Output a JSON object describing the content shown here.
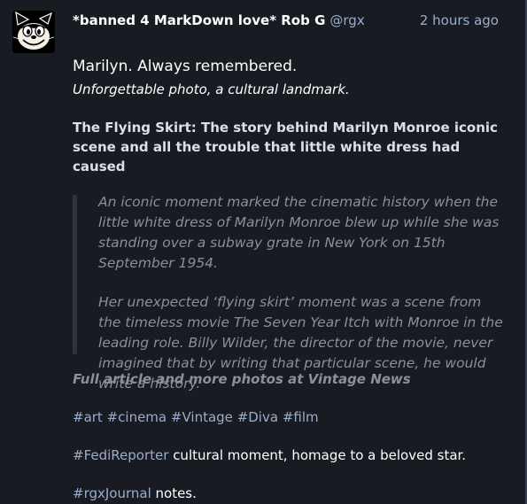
{
  "post": {
    "display_name": "*banned 4 MarkDown love* Rob G",
    "acct": "@rgx",
    "timestamp": "2 hours ago",
    "lead": "Marilyn. Always remembered.",
    "subtitle": "Unforgettable photo, a cultural landmark.",
    "article_title": "The Flying Skirt: The story behind Marilyn Monroe iconic scene and all the trouble that little white dress had caused",
    "quote_paragraphs": [
      "An iconic moment marked the cinematic history when the little white dress of Marilyn Monroe blew up while she was standing over a subway grate in New York on 15th September 1954.",
      "Her unexpected ‘flying skirt’ moment was a scene from the timeless movie The Seven Year Itch with Monroe in the leading role. Billy Wilder, the director of the movie, never imagined that by writing that particular scene, he would write a history."
    ],
    "full_article_link": "Full article and more photos at Vintage News",
    "hashtags": [
      "#art",
      "#cinema",
      "#Vintage",
      "#Diva",
      "#film"
    ],
    "reporter_tag": "#FediReporter",
    "reporter_text": " cultural moment, homage to a beloved star.",
    "journal_tag": "#rgxJournal",
    "journal_text": " notes."
  },
  "icons": {
    "avatar": "felix-cat-avatar"
  },
  "colors": {
    "background": "#191b22",
    "link": "#9baec8",
    "quote_text": "#8a8f99",
    "quote_bar": "#2f3340"
  }
}
